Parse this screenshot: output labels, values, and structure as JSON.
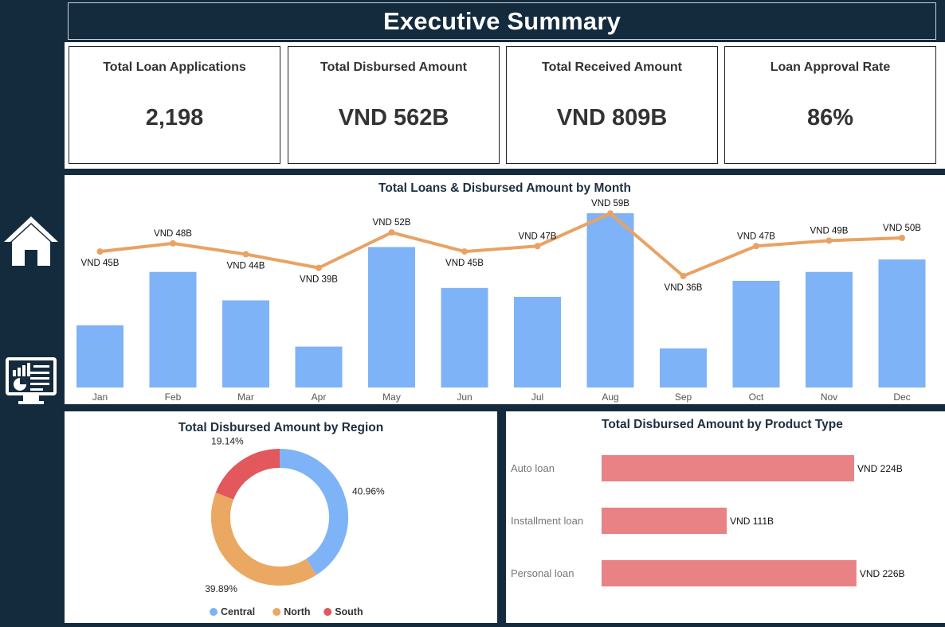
{
  "header": {
    "title": "Executive Summary"
  },
  "sidebar": {
    "items": [
      {
        "icon": "home-icon"
      },
      {
        "icon": "dashboard-monitor-icon"
      }
    ]
  },
  "kpis": [
    {
      "title": "Total Loan Applications",
      "value": "2,198"
    },
    {
      "title": "Total Disbursed Amount",
      "value": "VND 562B"
    },
    {
      "title": "Total Received Amount",
      "value": "VND 809B"
    },
    {
      "title": "Loan Approval Rate",
      "value": "86%"
    }
  ],
  "colors": {
    "navy": "#142b3e",
    "bar_blue": "#7eb3f7",
    "line_orange": "#e9a264",
    "region_central": "#7eb3f7",
    "region_north": "#eaa862",
    "region_south": "#e2585c",
    "product_bar": "#e88284"
  },
  "chart_data": [
    {
      "type": "bar",
      "title": "Total Loans & Disbursed Amount by Month",
      "categories": [
        "Jan",
        "Feb",
        "Mar",
        "Apr",
        "May",
        "Jun",
        "Jul",
        "Aug",
        "Sep",
        "Oct",
        "Nov",
        "Dec"
      ],
      "series": [
        {
          "kind": "bar",
          "values": [
            185,
            215,
            199,
            173,
            229,
            206,
            201,
            248,
            172,
            210,
            215,
            222
          ]
        },
        {
          "kind": "line",
          "values": [
            45,
            48,
            44,
            39,
            52,
            45,
            47,
            59,
            36,
            47,
            49,
            50
          ],
          "labels": [
            "VND 45B",
            "VND 48B",
            "VND 44B",
            "VND 39B",
            "VND 52B",
            "VND 45B",
            "VND 47B",
            "VND 59B",
            "VND 36B",
            "VND 47B",
            "VND 49B",
            "VND 50B"
          ]
        }
      ],
      "grid": false,
      "legend": "none"
    },
    {
      "type": "pie",
      "title": "Total Disbursed Amount by Region",
      "slices": [
        {
          "name": "Central",
          "value": 40.96,
          "label": "40.96%"
        },
        {
          "name": "North",
          "value": 39.89,
          "label": "39.89%"
        },
        {
          "name": "South",
          "value": 19.14,
          "label": "19.14%"
        }
      ],
      "donut": true,
      "legend": "bottom"
    },
    {
      "type": "bar",
      "orientation": "horizontal",
      "title": "Total Disbursed Amount by Product Type",
      "categories": [
        "Auto loan",
        "Installment loan",
        "Personal loan"
      ],
      "values": [
        224,
        111,
        226
      ],
      "labels": [
        "VND 224B",
        "VND 111B",
        "VND 226B"
      ],
      "xlim": [
        0,
        240
      ]
    }
  ]
}
